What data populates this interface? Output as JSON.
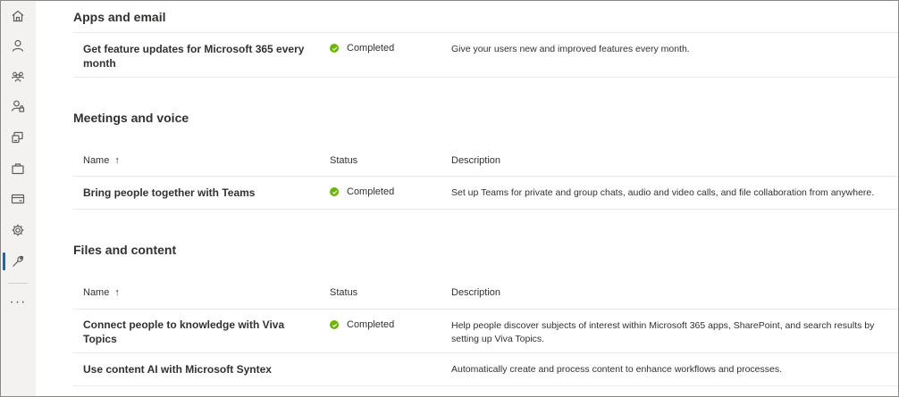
{
  "sections": {
    "apps": {
      "title": "Apps and email",
      "rows": [
        {
          "name": "Get feature updates for Microsoft 365 every month",
          "status": "Completed",
          "description": "Give your users new and improved features every month."
        }
      ]
    },
    "meetings": {
      "title": "Meetings and voice",
      "headers": {
        "name": "Name",
        "status": "Status",
        "description": "Description"
      },
      "rows": [
        {
          "name": "Bring people together with Teams",
          "status": "Completed",
          "description": "Set up Teams for private and group chats, audio and video calls, and file collaboration from anywhere."
        }
      ]
    },
    "files": {
      "title": "Files and content",
      "headers": {
        "name": "Name",
        "status": "Status",
        "description": "Description"
      },
      "rows": [
        {
          "name": "Connect people to knowledge with Viva Topics",
          "status": "Completed",
          "description": "Help people discover subjects of interest within Microsoft 365 apps, SharePoint, and search results by setting up Viva Topics."
        },
        {
          "name": "Use content AI with Microsoft Syntex",
          "status": "",
          "description": "Automatically create and process content to enhance workflows and processes."
        }
      ]
    }
  },
  "rail": {
    "icons": [
      "home-icon",
      "user-icon",
      "group-icon",
      "user-lock-icon",
      "devices-icon",
      "briefcase-icon",
      "billing-card-icon",
      "settings-icon",
      "wrench-icon"
    ],
    "active": "wrench-icon",
    "more_label": "···"
  },
  "colors": {
    "completed": "#6bb700",
    "accent": "#0f6cbd",
    "rail_bg": "#f3f2f1"
  }
}
